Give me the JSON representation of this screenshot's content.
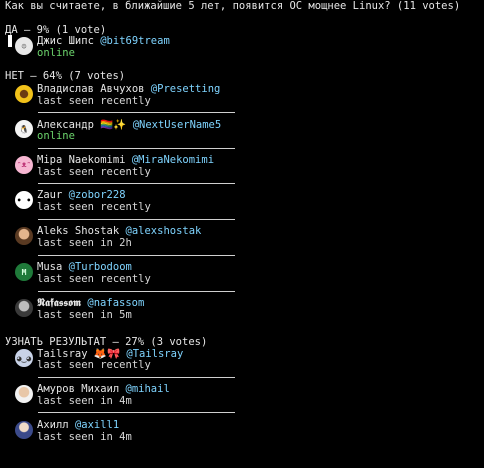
{
  "question": "Как вы считаете, в ближайшие 5 лет, появится ОС мощнее Linux? (11 votes)",
  "options": [
    {
      "header": "ДА – 9% (1 vote)",
      "voters": [
        {
          "name": "Джис Шипс",
          "username": "@bit69tream",
          "status": "online",
          "avatar": "sketch-face-avatar"
        }
      ]
    },
    {
      "header": "НЕТ – 64% (7 votes)",
      "voters": [
        {
          "name": "Владислав Авчухов",
          "username": "@Presetting",
          "status": "last seen recently",
          "avatar": "sunflower-avatar"
        },
        {
          "name": "Александр 🏳️‍🌈✨",
          "username": "@NextUserName5",
          "status": "online",
          "avatar": "penguin-avatar"
        },
        {
          "name": "Міра Naekomimi",
          "username": "@MiraNekomimi",
          "status": "last seen recently",
          "avatar": "pink-cat-avatar"
        },
        {
          "name": "Zaur",
          "username": "@zobor228",
          "status": "last seen recently",
          "avatar": "white-blob-avatar"
        },
        {
          "name": "Aleks Shostak",
          "username": "@alexshostak",
          "status": "last seen in 2h",
          "avatar": "photo-avatar"
        },
        {
          "name": "Musa",
          "username": "@Turbodoom",
          "status": "last seen recently",
          "avatar": "letter-m-avatar"
        },
        {
          "name": "𝕹𝖆𝖋𝖆𝖘𝖘𝖔𝖒",
          "username": "@nafassom",
          "status": "last seen in 5m",
          "avatar": "gray-photo-avatar"
        }
      ]
    },
    {
      "header": "УЗНАТЬ РЕЗУЛЬТАТ – 27% (3 votes)",
      "voters": [
        {
          "name": "Tailsray 🦊🎀",
          "username": "@Tailsray",
          "status": "last seen recently",
          "avatar": "fox-avatar"
        },
        {
          "name": "Амуров Михаил",
          "username": "@mihail",
          "status": "last seen in 4m",
          "avatar": "portrait-avatar"
        },
        {
          "name": "Ахилл",
          "username": "@axill1",
          "status": "last seen in 4m",
          "avatar": "anime-avatar"
        }
      ]
    }
  ],
  "colors": {
    "background": "#000000",
    "text": "#e6e6e6",
    "username": "#7fd4ff",
    "online": "#6cd46c",
    "separator": "#cfcfcf"
  }
}
